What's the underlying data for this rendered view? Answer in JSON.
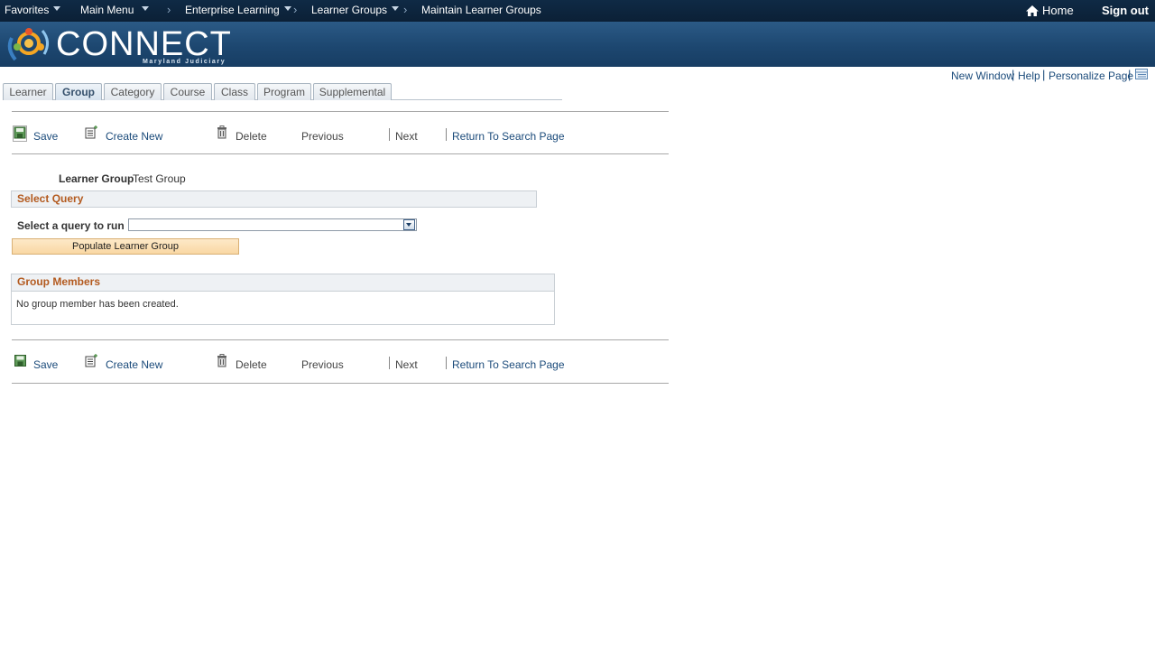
{
  "nav": {
    "favorites": "Favorites",
    "main_menu": "Main Menu",
    "breadcrumbs": [
      "Enterprise Learning",
      "Learner Groups",
      "Maintain Learner Groups"
    ],
    "home": "Home",
    "sign_out": "Sign out"
  },
  "banner": {
    "logo_text": "CONNECT",
    "logo_subtext": "Maryland Judiciary"
  },
  "utility_links": [
    "New Window",
    "Help",
    "Personalize Page"
  ],
  "tabs": [
    {
      "label": "Learner",
      "active": false
    },
    {
      "label": "Group",
      "active": true
    },
    {
      "label": "Category",
      "active": false
    },
    {
      "label": "Course",
      "active": false
    },
    {
      "label": "Class",
      "active": false
    },
    {
      "label": "Program",
      "active": false
    },
    {
      "label": "Supplemental",
      "active": false
    }
  ],
  "toolbar": {
    "save": "Save",
    "create_new": "Create New",
    "delete": "Delete",
    "previous": "Previous",
    "next": "Next",
    "return_to_search": "Return To Search Page"
  },
  "form": {
    "learner_group_label": "Learner Group",
    "learner_group_value": "Test Group",
    "select_query_header": "Select Query",
    "select_query_label": "Select a query to run",
    "select_query_value": "",
    "populate_button": "Populate Learner Group"
  },
  "members": {
    "header": "Group Members",
    "empty_message": "No group member has been created."
  },
  "colors": {
    "nav_bg": "#0f2a45",
    "banner_bg": "#1d4770",
    "link": "#1a4a7a",
    "section_title": "#b35a1f",
    "populate_bg": "#fbe0b4"
  }
}
